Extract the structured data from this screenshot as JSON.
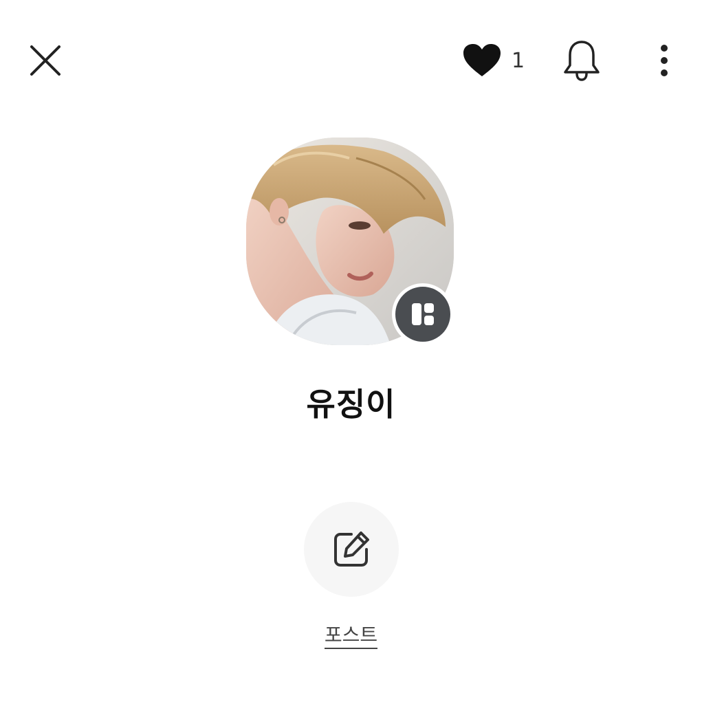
{
  "header": {
    "close_icon": "close-icon",
    "like_icon": "heart-icon",
    "like_count": "1",
    "notification_icon": "bell-icon",
    "more_icon": "more-vertical-icon"
  },
  "profile": {
    "name": "유징이",
    "avatar": "profile-photo",
    "badge_icon": "profile-switch-icon"
  },
  "actions": {
    "post_icon": "edit-icon",
    "post_label": "포스트"
  },
  "colors": {
    "text": "#111111",
    "badge_bg": "#4a4d51",
    "action_bg": "#f6f6f6",
    "icon": "#333333"
  }
}
